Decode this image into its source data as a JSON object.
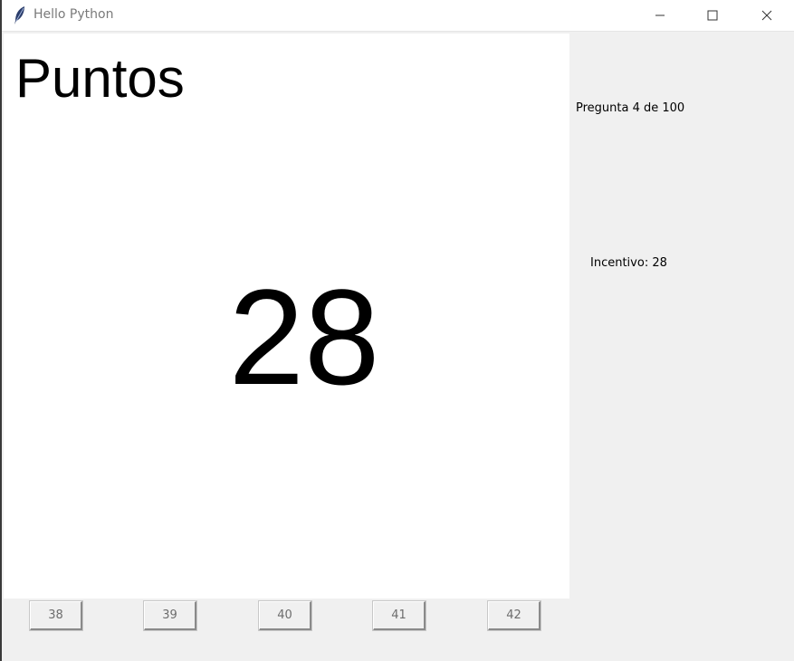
{
  "window": {
    "title": "Hello Python"
  },
  "canvas": {
    "heading": "Puntos",
    "value": "28"
  },
  "sidebar": {
    "question_label": "Pregunta 4 de 100",
    "incentive_label": "Incentivo: 28"
  },
  "answers": [
    "38",
    "39",
    "40",
    "41",
    "42"
  ],
  "icons": {
    "app": "feather-icon",
    "minimize": "minimize-icon",
    "maximize": "maximize-icon",
    "close": "close-icon"
  }
}
